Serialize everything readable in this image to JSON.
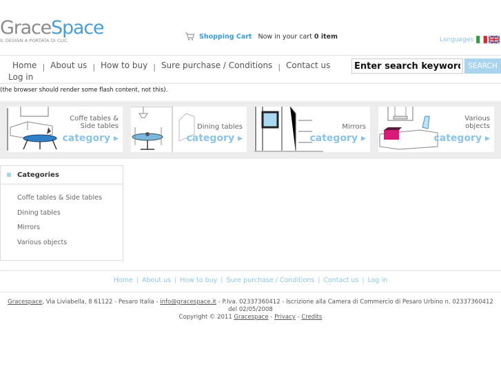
{
  "header": {
    "logo": {
      "part1": "Grace",
      "part2": "Space",
      "tagline": "IL DESIGN A PORTATA DI CLIC"
    },
    "cart": {
      "title": "Shopping Cart",
      "status": "Now in your cart",
      "count": "0 item"
    },
    "languages_label": "Languages",
    "flags": [
      "italian-flag",
      "uk-flag"
    ]
  },
  "nav": {
    "items": [
      "Home",
      "About us",
      "How to buy",
      "Sure purchase / Conditions",
      "Contact us"
    ],
    "login": "Log in",
    "separator": "|"
  },
  "search": {
    "value": "Enter search keywords here",
    "button": "SEARCH"
  },
  "flash_message": "(the browser should render some flash content, not this).",
  "banner": {
    "tiles": [
      {
        "title_line1": "Coffe tables &",
        "title_line2": "Side tables",
        "cta": "category ▸"
      },
      {
        "title_line1": "Dining tables",
        "title_line2": "",
        "cta": "category ▸"
      },
      {
        "title_line1": "Mirrors",
        "title_line2": "",
        "cta": "category ▸"
      },
      {
        "title_line1": "Various",
        "title_line2": "objects",
        "cta": "category ▸"
      }
    ]
  },
  "sidebar": {
    "title": "Categories",
    "items": [
      "Coffe tables & Side tables",
      "Dining tables",
      "Mirrors",
      "Various objects"
    ]
  },
  "footer": {
    "nav": [
      "Home",
      "About us",
      "How to buy",
      "Sure purchase / Conditions",
      "Contact us",
      "Log in"
    ],
    "company_link": "Gracespace",
    "address": ", Via Liviabella, 8 61122 - Pesaro Italia - ",
    "email": "info@gracespace.it",
    "legal": " - P.Iva. 02337360412 - Iscrizione alla Camera di Commercio di Pesaro Urbino n. 02337360412 del 02/05/2008",
    "copyright": "Copyright © 2011 ",
    "copyright_link": "Gracespace",
    "privacy": "Privacy",
    "credits": "Credits",
    "dash": " - "
  },
  "colors": {
    "accent": "#4a9fd0",
    "light_accent": "#a9d4ee",
    "link": "#8cc6e8"
  }
}
